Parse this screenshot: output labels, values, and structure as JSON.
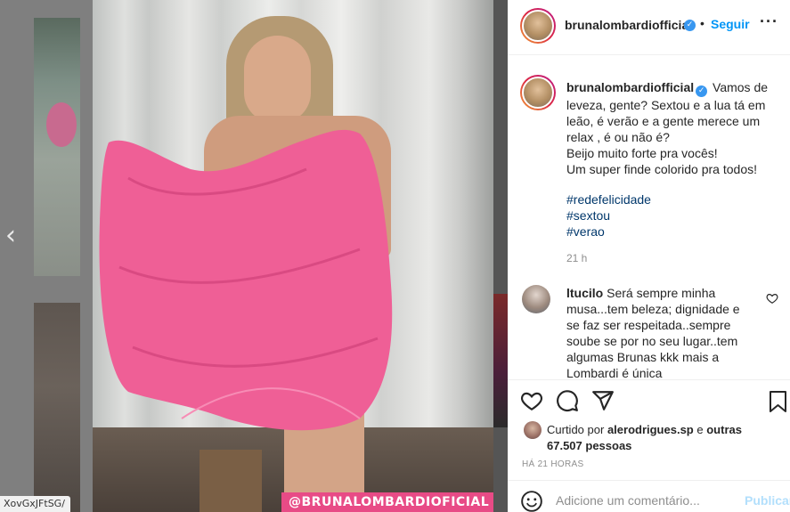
{
  "backdrop": {
    "url_fragment": "XovGxJFtSG/",
    "prev_arrow": "‹"
  },
  "photo": {
    "watermark": "@BRUNALOMBARDIOFICIAL"
  },
  "header": {
    "username": "brunalombardiofficial",
    "separator": "•",
    "follow_label": "Seguir",
    "more_label": "···"
  },
  "caption": {
    "username": "brunalombardiofficial",
    "lines": [
      "Vamos de leveza, gente? Sextou e a lua tá em leão, é verão e a gente merece um relax , é ou não é?",
      "Beijo muito forte pra vocês!",
      "Um super finde colorido pra todos!"
    ],
    "hashtags": [
      "#redefelicidade",
      "#sextou",
      "#verao"
    ],
    "time": "21 h"
  },
  "comment": {
    "username": "ltucilo",
    "text": "Será sempre minha musa...tem beleza; dignidade e se faz ser respeitada..sempre soube se por no seu lugar..tem algumas Brunas kkk mais a Lombardi é única"
  },
  "likes": {
    "prefix": "Curtido por",
    "user": "alerodrigues.sp",
    "joiner": "e",
    "others": "outras 67.507 pessoas"
  },
  "timestamp": "HÁ 21 HORAS",
  "add_comment": {
    "placeholder": "Adicione um comentário...",
    "publish_label": "Publicar"
  },
  "icons": {
    "like": "heart-icon",
    "comment": "comment-icon",
    "share": "share-icon",
    "save": "bookmark-icon",
    "verified": "verified-badge-icon",
    "emoji": "emoji-icon"
  },
  "colors": {
    "accent": "#0095f6",
    "hashtag": "#00376b",
    "publish_disabled": "#b2dffc",
    "sarong": "#ef5f96",
    "watermark_bg": "#e84b86"
  }
}
